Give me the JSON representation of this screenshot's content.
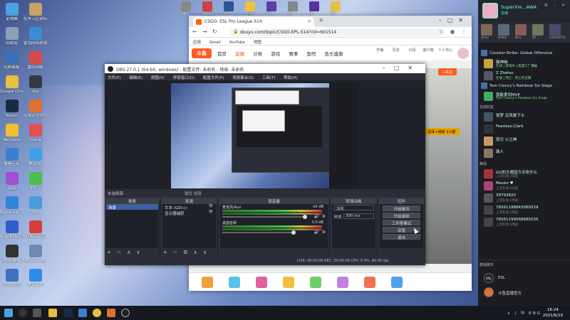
{
  "desktop": {
    "icons": [
      {
        "label": "此电脑",
        "color": "#4aa3e0"
      },
      {
        "label": "在学习区别标",
        "color": "#c9a36a"
      },
      {
        "label": "回收站",
        "color": "#8aa0b8"
      },
      {
        "label": "雷雨网络游戏",
        "color": "#3b8cd6"
      },
      {
        "label": "控制面板",
        "color": "#3a6fb8"
      },
      {
        "label": "雷雨网络",
        "color": "#d84a4a"
      },
      {
        "label": "Google Chrome",
        "color": "#e8c040"
      },
      {
        "label": "obs",
        "color": "#333842"
      },
      {
        "label": "Steam",
        "color": "#1b2a44"
      },
      {
        "label": "火绒安全软件",
        "color": "#e07030"
      },
      {
        "label": "WeGame",
        "color": "#f0c030"
      },
      {
        "label": "Oracle",
        "color": "#e05050"
      },
      {
        "label": "看看应用",
        "color": "#3c7fd0"
      },
      {
        "label": "腾讯QQ",
        "color": "#3fa0e8"
      },
      {
        "label": "Gfgt",
        "color": "#a050d0"
      },
      {
        "label": "爱奇艺",
        "color": "#4cbf4c"
      },
      {
        "label": "Battle.net Games Lib",
        "color": "#2f86d8"
      },
      {
        "label": "Bili",
        "color": "#4b9bd8"
      },
      {
        "label": "网易UU加速器",
        "color": "#2f5cc8"
      },
      {
        "label": "网易云音乐",
        "color": "#d83c3c"
      },
      {
        "label": "EGS 游戏",
        "color": "#333"
      },
      {
        "label": "VMware Workstation",
        "color": "#6f8ab0"
      },
      {
        "label": "SGG 游戏",
        "color": "#4070c0"
      },
      {
        "label": "腾讯会议",
        "color": "#2d8ce8"
      }
    ],
    "top_icons": [
      {
        "label": "2B",
        "color": "#888"
      },
      {
        "label": "Adobe",
        "color": "#d04040"
      },
      {
        "label": "W",
        "color": "#2b5797"
      },
      {
        "label": "文件",
        "color": "#f0c040"
      },
      {
        "label": "VS",
        "color": "#5d3fa0"
      },
      {
        "label": "图",
        "color": "#888"
      },
      {
        "label": "Pr",
        "color": "#5a2fa0"
      },
      {
        "label": "Ch",
        "color": "#e8c040"
      }
    ]
  },
  "chrome": {
    "tab_title": "CSGO: ESL Pro League S14",
    "url": "douyu.com/topic/CSGO-EPL-S14?rid=601514",
    "bookmarks": [
      "应用",
      "Gmail",
      "YouTube",
      "地图"
    ],
    "nav_items": [
      "首页",
      "直播",
      "分类",
      "游戏",
      "赛事",
      "鱼吧",
      "鱼乐盛典"
    ],
    "active_nav": "直播",
    "right_items": [
      "开播",
      "历史",
      "订阅",
      "客户端",
      "个人中心"
    ],
    "logo": "斗鱼",
    "follow_label": "+关注",
    "golden_label": "冠军+铁粉 1火箭",
    "gift_count": 8
  },
  "obs": {
    "title": "OBS 27.0.1 (64-bit, windows) - 配置文件: 未命名 - 场景: 未命名",
    "menu": [
      "文件(F)",
      "编辑(E)",
      "视图(V)",
      "停靠窗口(D)",
      "配置文件(P)",
      "场景集合(S)",
      "工具(T)",
      "帮助(H)"
    ],
    "scene_bar_left": "未选择源",
    "scene_bar_mid": "属性    滤镜",
    "docks": {
      "scenes": {
        "title": "场景",
        "items": [
          "场景"
        ]
      },
      "sources": {
        "title": "来源",
        "items": [
          "文本 (GDI+)",
          "显示器捕获"
        ]
      },
      "mixer": {
        "title": "混音器",
        "channels": [
          {
            "name": "麦克风/Aux",
            "value": "-inf dB",
            "level": 0.95
          },
          {
            "name": "桌面音频",
            "value": "0.0 dB",
            "level": 0.82
          }
        ]
      },
      "transitions": {
        "title": "转场动画",
        "type": "淡化",
        "duration_label": "时长",
        "duration": "300 ms"
      },
      "controls": {
        "title": "控件",
        "buttons": [
          "开始推流",
          "开始录制",
          "工作室模式",
          "设置",
          "退出"
        ]
      }
    },
    "status": "LIVE: 00:00:00    REC: 00:00:00    CPU: 0.9%, 60.00 fps"
  },
  "steam": {
    "username": "SuperXie...AWA",
    "status": "在线",
    "top_strip": [
      "zhou",
      "KAKA",
      "Nov",
      "Mi",
      "GIGABYTE"
    ],
    "section_game1": "Counter-Strike: Global Offensive",
    "friends_game1": [
      {
        "name": "猫神纳",
        "status": "在线 | 游戏中 | 能量工厂爆破",
        "color": "#c8a040"
      },
      {
        "name": "Z Zhetsu",
        "status": "在线 | 死亡 - 死亡的竞赛",
        "color": "#556"
      }
    ],
    "section_game2": "Tom Clancy's Rainbow Six Siege",
    "friends_game2": [
      {
        "name": "我能拿到MVP",
        "status": "Tom Clancy's Rainbow Six Siege",
        "color": "#4a6"
      }
    ],
    "section_online": "在线好友",
    "friends_online": [
      {
        "name": "坂梦 北风是下士",
        "color": "#456"
      },
      {
        "name": "Fearless.Clark",
        "color": "#333"
      },
      {
        "name": "雨引 火之神",
        "color": "#c96"
      },
      {
        "name": "路人",
        "color": "#876"
      }
    ],
    "section_offline": "离线",
    "friends_offline": [
      {
        "name": "GG的大佬因今天吃什么",
        "status": "上次在线 2天前",
        "color": "#a33"
      },
      {
        "name": "Meoko ♥",
        "status": "上次在线 5天前",
        "color": "#a47"
      },
      {
        "name": "39793820",
        "status": "上次在线 1周前",
        "color": "#555"
      },
      {
        "name": "76561198843060019",
        "status": "上次在线 1周前",
        "color": "#444"
      },
      {
        "name": "76561199068685035",
        "status": "上次在线 2周前",
        "color": "#444"
      }
    ],
    "footer_label": "群组聊天",
    "groups": [
      "ESL",
      "斗鱼直播官方"
    ]
  },
  "taskbar": {
    "tray": "∧ ♪ 中 ENG",
    "time": "16:24",
    "date": "2021/6/19"
  }
}
